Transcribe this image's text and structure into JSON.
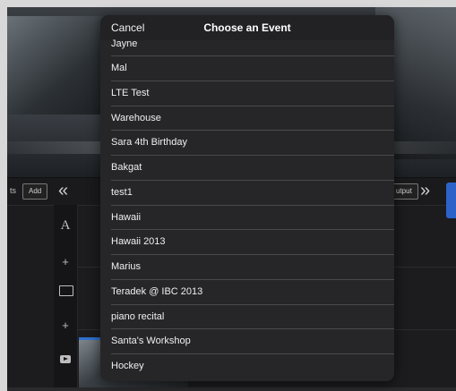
{
  "app": {
    "toolbar": {
      "left_text": "ts",
      "add_label": "Add",
      "left_chevron": "«",
      "output_label": "utput",
      "right_chevron": "»"
    },
    "sidebar": {
      "text_icon": "A",
      "plus1": "+",
      "plus2": "+"
    }
  },
  "popover": {
    "cancel_label": "Cancel",
    "title": "Choose an Event",
    "events": [
      "Jayne",
      "Mal",
      "LTE Test",
      "Warehouse",
      "Sara 4th Birthday",
      "Bakgat",
      "test1",
      "Hawaii",
      "Hawaii 2013",
      "Marius",
      "Teradek @ IBC 2013",
      "piano recital",
      "Santa's Workshop",
      "Hockey"
    ]
  },
  "icons": {
    "text_tool": "text-icon",
    "image_tool": "image-icon",
    "video_tool": "video-play-icon"
  },
  "colors": {
    "popover_bg": "#262628",
    "accent_blue": "#2d63c8"
  }
}
